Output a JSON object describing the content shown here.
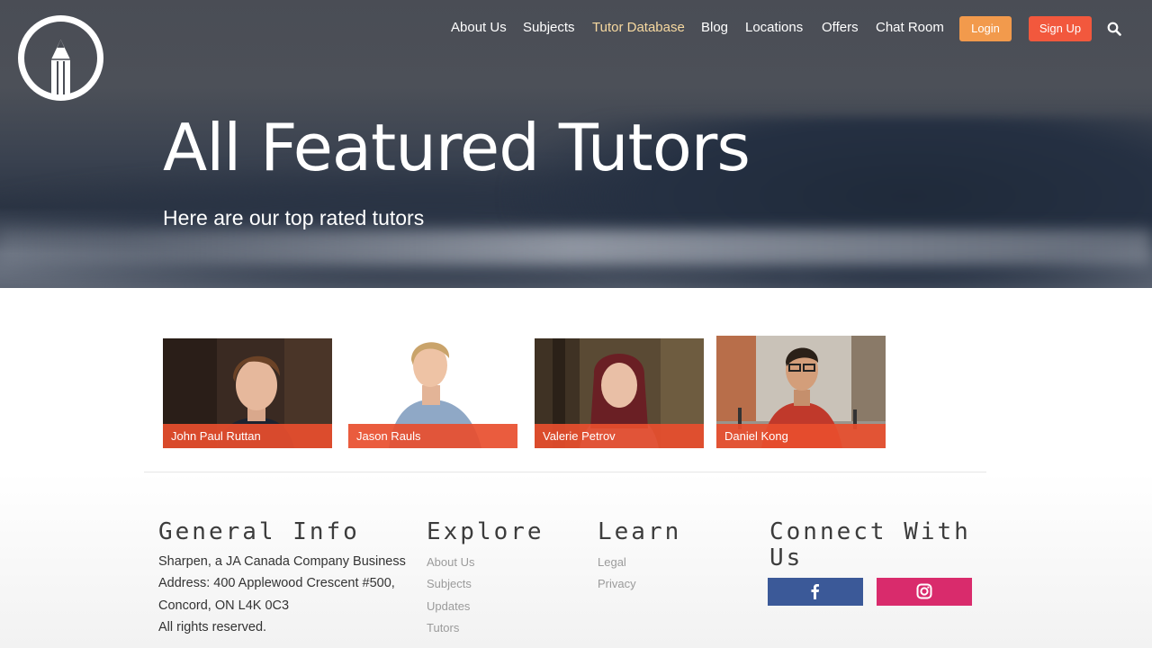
{
  "nav": {
    "items": [
      {
        "label": "About Us",
        "active": false
      },
      {
        "label": "Subjects",
        "active": false
      },
      {
        "label": "Tutor Database",
        "active": true
      },
      {
        "label": "Blog",
        "active": false
      },
      {
        "label": "Locations",
        "active": false
      },
      {
        "label": "Offers",
        "active": false
      },
      {
        "label": "Chat Room",
        "active": false
      }
    ],
    "login_label": "Login",
    "signup_label": "Sign Up",
    "search_icon": "search-icon"
  },
  "hero": {
    "title": "All Featured Tutors",
    "subtitle": "Here are our top rated tutors"
  },
  "tutors": [
    {
      "name": "John Paul Ruttan"
    },
    {
      "name": "Jason Rauls"
    },
    {
      "name": "Valerie Petrov"
    },
    {
      "name": "Daniel Kong"
    }
  ],
  "footer": {
    "general": {
      "heading": "General Info",
      "lines": [
        "Sharpen, a JA Canada Company Business",
        "Address: 400 Applewood Crescent #500,",
        "Concord, ON L4K 0C3",
        "All rights reserved."
      ]
    },
    "explore": {
      "heading": "Explore",
      "links": [
        "About Us",
        "Subjects",
        "Updates",
        "Tutors"
      ]
    },
    "learn": {
      "heading": "Learn",
      "links": [
        "Legal",
        "Privacy"
      ]
    },
    "connect": {
      "heading_line1": "Connect With",
      "heading_line2": "Us",
      "facebook_icon": "facebook-icon",
      "instagram_icon": "instagram-icon"
    }
  },
  "colors": {
    "accent_orange": "#f29a4c",
    "accent_red": "#f2583d",
    "tutor_label": "#e84e2e",
    "facebook": "#3b5998",
    "instagram": "#d92b6c"
  }
}
